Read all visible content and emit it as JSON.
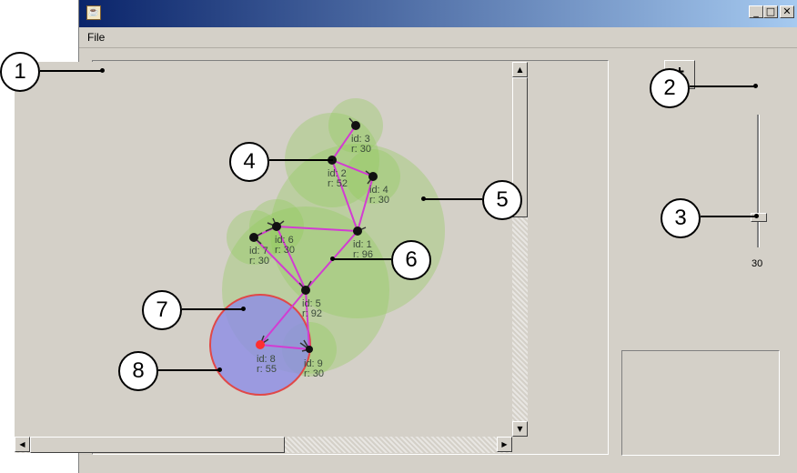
{
  "menu": {
    "file_label": "File"
  },
  "window": {
    "minimize_glyph": "_",
    "maximize_glyph": "□",
    "close_glyph": "✕",
    "app_icon": "java-cup-icon"
  },
  "slider": {
    "value": "30",
    "level": 30
  },
  "add_button": {
    "icon": "add-node-icon"
  },
  "callouts": [
    "1",
    "2",
    "3",
    "4",
    "5",
    "6",
    "7",
    "8"
  ],
  "scroll": {
    "up": "▲",
    "down": "▼",
    "left": "◀",
    "right": "▶"
  },
  "nodes": [
    {
      "id_label": "id: 3",
      "r_label": "r: 30"
    },
    {
      "id_label": "id: 2",
      "r_label": "r: 52"
    },
    {
      "id_label": "id: 4",
      "r_label": "r: 30"
    },
    {
      "id_label": "id: 1",
      "r_label": "r: 96"
    },
    {
      "id_label": "id: 6",
      "r_label": "r: 30"
    },
    {
      "id_label": "id: 7",
      "r_label": "r: 30"
    },
    {
      "id_label": "id: 5",
      "r_label": "r: 92"
    },
    {
      "id_label": "id: 8",
      "r_label": "r: 55"
    },
    {
      "id_label": "id: 9",
      "r_label": "r: 30"
    }
  ],
  "colors": {
    "range_fill": "#8fcc5a",
    "edge": "#d23cd2",
    "selected_fill": "#8c8ce6",
    "selected_stroke": "#e04848",
    "selected_node": "#ff3030",
    "node": "#111111",
    "title_start": "#0a246a",
    "title_end": "#a6caf0"
  }
}
